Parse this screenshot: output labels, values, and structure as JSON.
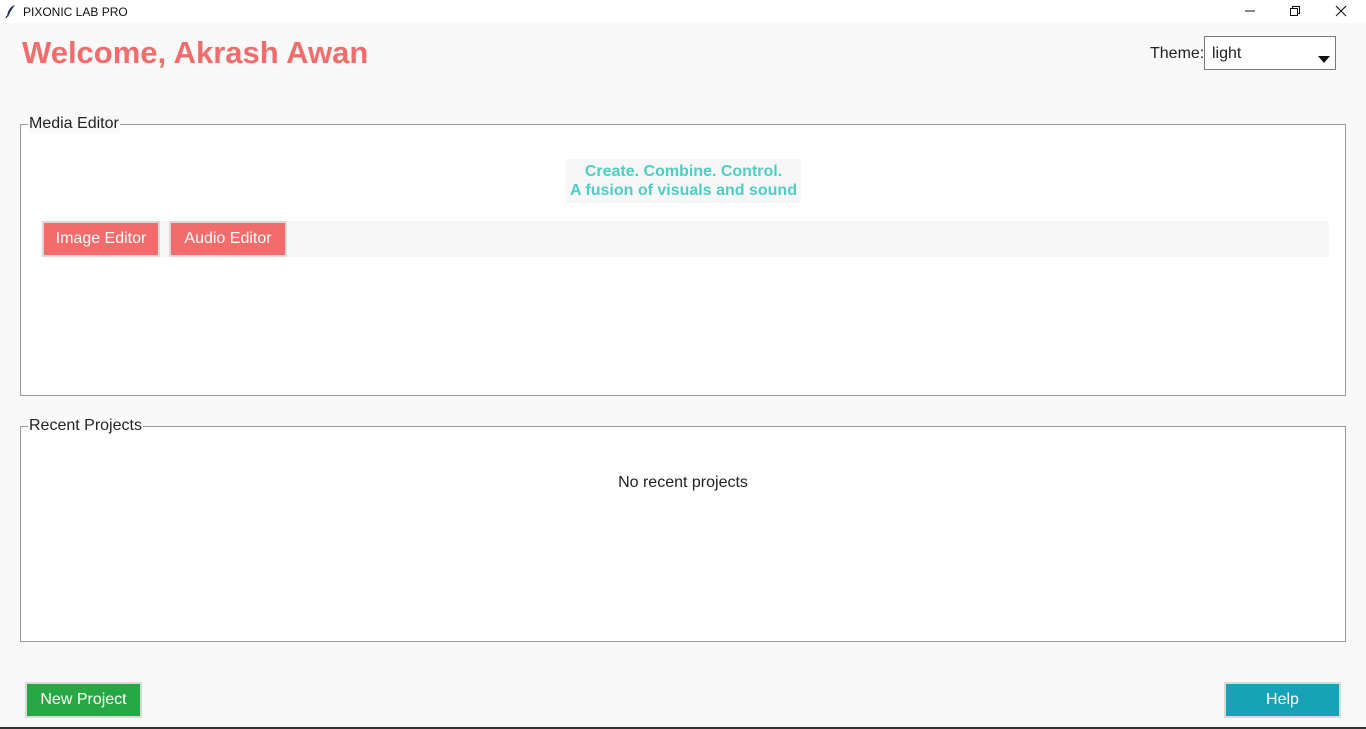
{
  "window": {
    "title": "PIXONIC LAB PRO",
    "app_icon": "feather-icon",
    "controls": [
      "minimize-icon",
      "restore-icon",
      "close-icon"
    ]
  },
  "header": {
    "welcome_text": "Welcome, Akrash Awan",
    "theme_label": "Theme:",
    "theme_value": "light"
  },
  "media_editor": {
    "legend": "Media Editor",
    "tagline_line1": "Create. Combine. Control.",
    "tagline_line2": "A fusion of visuals and sound",
    "image_editor_label": "Image Editor",
    "audio_editor_label": "Audio Editor"
  },
  "recent_projects": {
    "legend": "Recent Projects",
    "empty_text": "No recent projects"
  },
  "footer": {
    "new_project_label": "New Project",
    "help_label": "Help"
  },
  "colors": {
    "accent_red": "#f36c6c",
    "tagline_teal": "#4ecdc4",
    "new_project_green": "#28a745",
    "help_cyan": "#17a2b8"
  }
}
